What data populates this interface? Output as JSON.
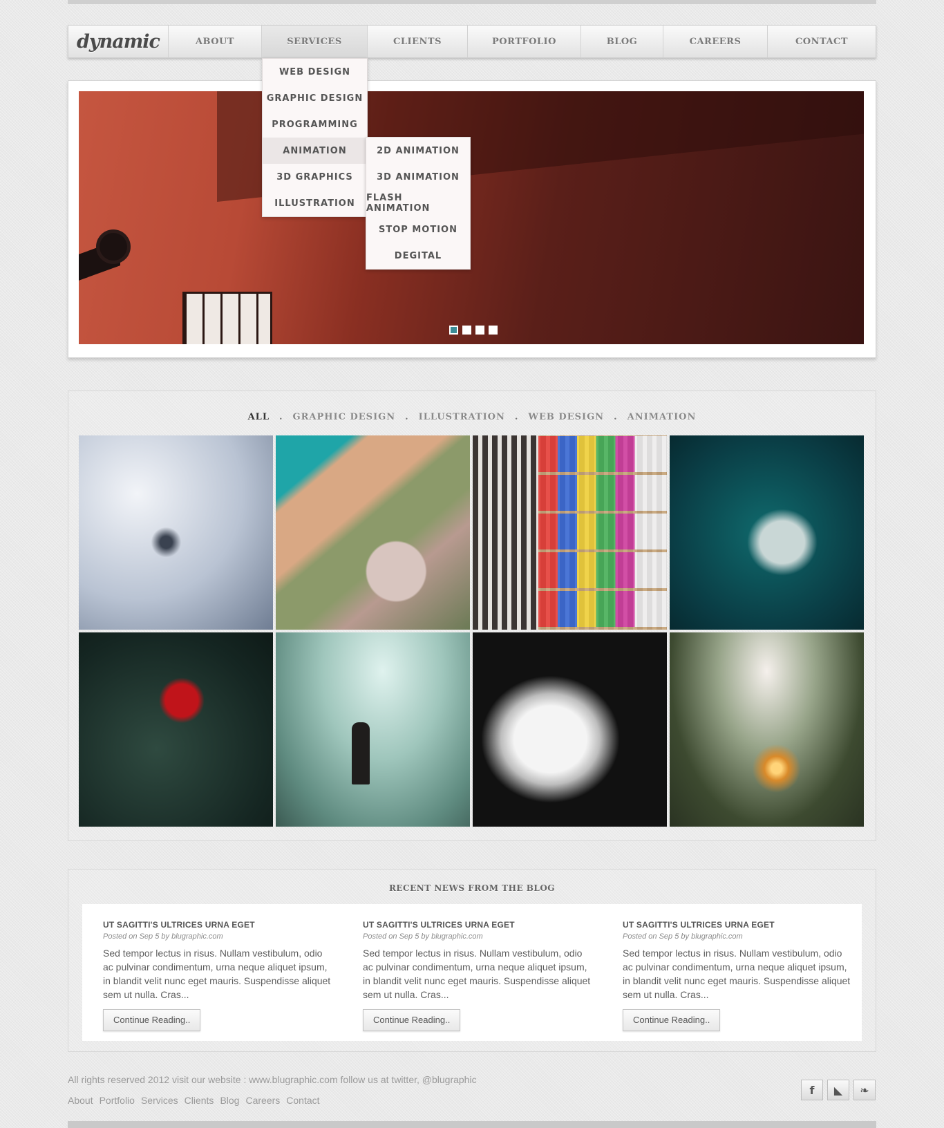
{
  "nav": {
    "logo": "dynamic",
    "items": [
      "ABOUT",
      "SERVICES",
      "CLIENTS",
      "PORTFOLIO",
      "BLOG",
      "CAREERS",
      "CONTACT"
    ],
    "active": "SERVICES"
  },
  "services_menu": [
    "WEB DESIGN",
    "GRAPHIC DESIGN",
    "PROGRAMMING",
    "ANIMATION",
    "3D GRAPHICS",
    "ILLUSTRATION"
  ],
  "animation_submenu": [
    "2D ANIMATION",
    "3D ANIMATION",
    "FLASH ANIMATION",
    "STOP MOTION",
    "DEGITAL"
  ],
  "slider": {
    "slides": 4,
    "active_slide": 1
  },
  "portfolio": {
    "filters": [
      "ALL",
      "GRAPHIC DESIGN",
      "ILLUSTRATION",
      "WEB DESIGN",
      "ANIMATION"
    ],
    "active_filter": "ALL",
    "separator": "."
  },
  "blog": {
    "title": "RECENT NEWS FROM THE BLOG",
    "posts": [
      {
        "title": "UT SAGITTI'S ULTRICES URNA EGET",
        "meta": "Posted on Sep 5 by blugraphic.com",
        "excerpt": "Sed tempor lectus in risus. Nullam vestibulum, odio ac pulvinar condimentum, urna neque aliquet ipsum, in blandit velit nunc eget mauris. Suspendisse aliquet sem ut nulla. Cras...",
        "button": "Continue Reading.."
      },
      {
        "title": "UT SAGITTI'S ULTRICES URNA EGET",
        "meta": "Posted on Sep 5 by blugraphic.com",
        "excerpt": "Sed tempor lectus in risus. Nullam vestibulum, odio ac pulvinar condimentum, urna neque aliquet ipsum, in blandit velit nunc eget mauris. Suspendisse aliquet sem ut nulla. Cras...",
        "button": "Continue Reading.."
      },
      {
        "title": "UT SAGITTI'S ULTRICES URNA EGET",
        "meta": "Posted on Sep 5 by blugraphic.com",
        "excerpt": "Sed tempor lectus in risus. Nullam vestibulum, odio ac pulvinar condimentum, urna neque aliquet ipsum, in blandit velit nunc eget mauris. Suspendisse aliquet sem ut nulla. Cras...",
        "button": "Continue Reading.."
      }
    ]
  },
  "footer": {
    "text": "All rights reserved 2012 visit our website : www.blugraphic.com follow us at twitter, @blugraphic",
    "links": [
      "About",
      "Portfolio",
      "Services",
      "Clients",
      "Blog",
      "Careers",
      "Contact"
    ],
    "social": [
      {
        "name": "facebook-icon",
        "glyph": "f"
      },
      {
        "name": "rss-icon",
        "glyph": "◣"
      },
      {
        "name": "twitter-icon",
        "glyph": "❧"
      }
    ]
  },
  "colors": {
    "accent": "#3c8d97",
    "background": "#e9e9e9"
  }
}
